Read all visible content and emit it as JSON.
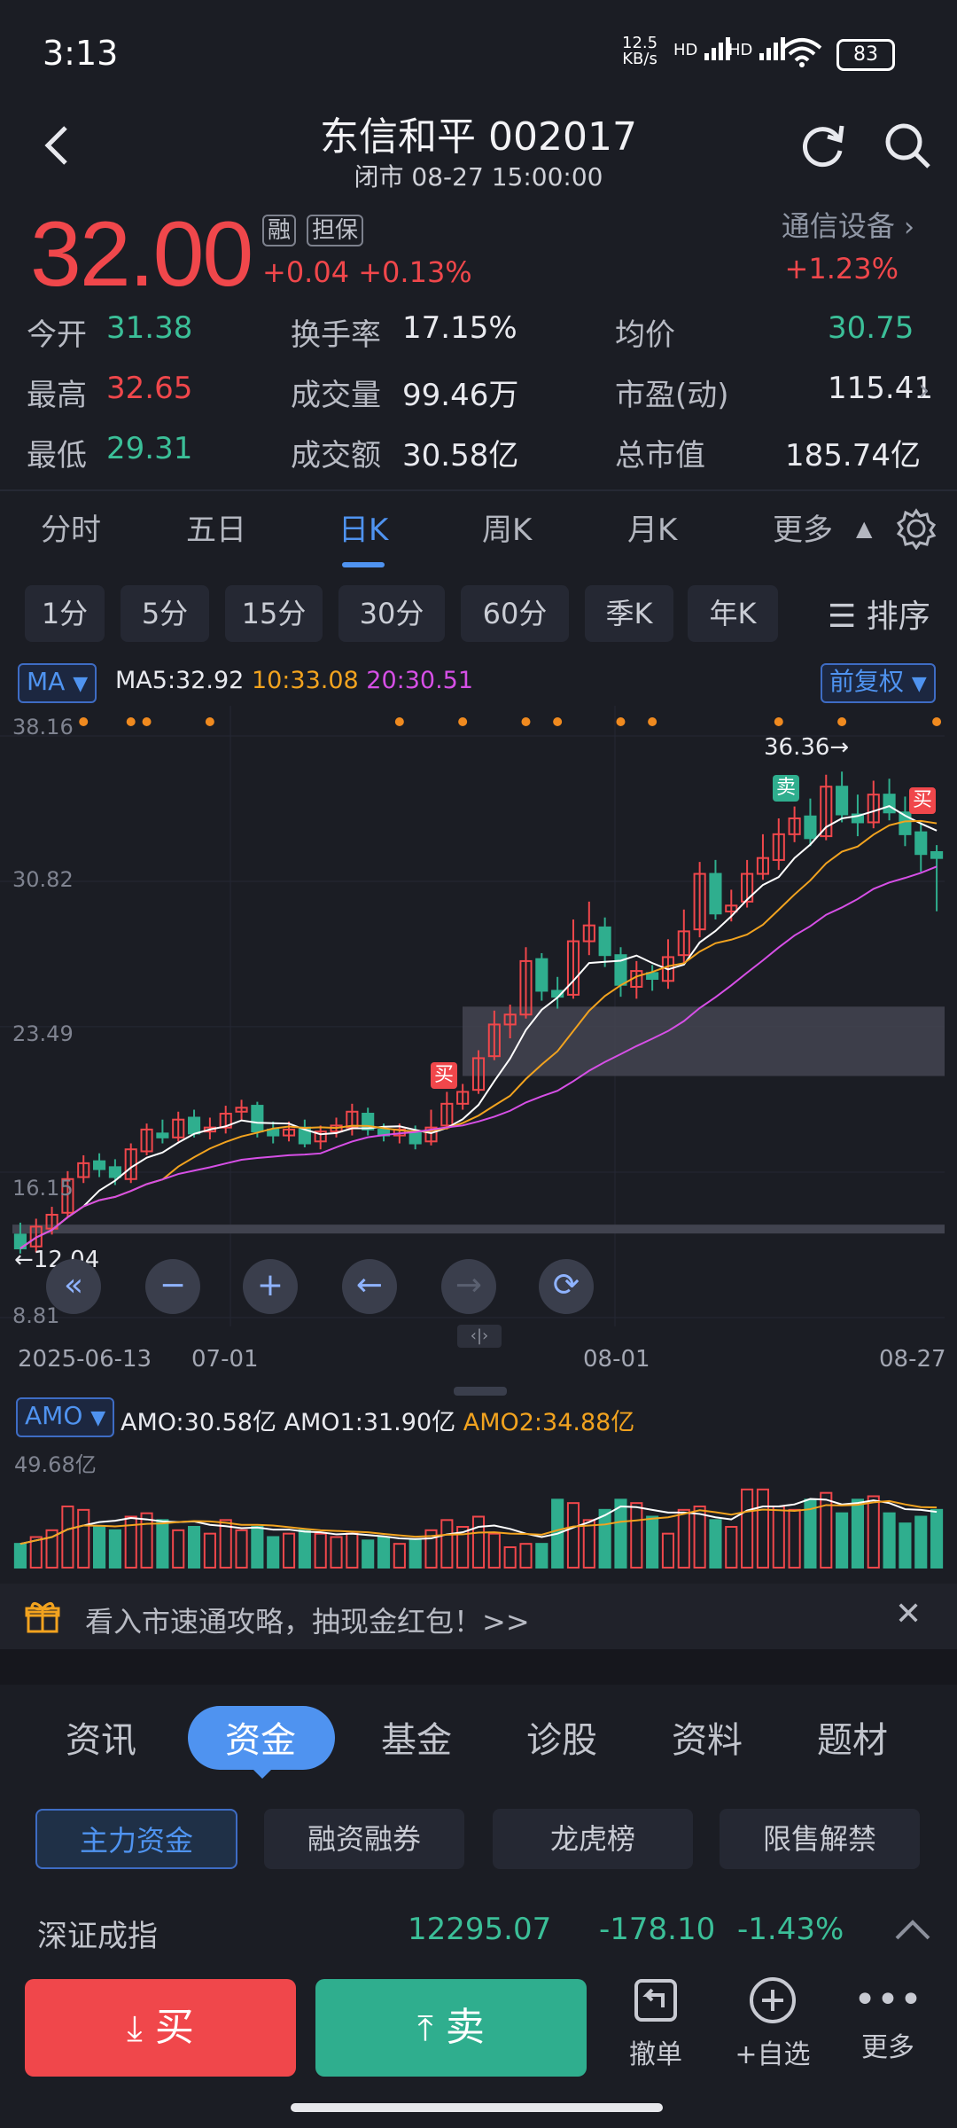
{
  "status": {
    "time": "3:13",
    "net_speed_top": "12.5",
    "net_speed_bottom": "KB/s",
    "hd1": "HD",
    "hd2": "HD",
    "battery": "83"
  },
  "header": {
    "title": "东信和平 002017",
    "subtitle": "闭市 08-27 15:00:00"
  },
  "quote": {
    "price": "32.00",
    "change": "+0.04",
    "change_pct": "+0.13%",
    "badge_rong": "融",
    "badge_danbao": "担保",
    "sector": "通信设备",
    "sector_change": "+1.23%",
    "stats": [
      {
        "label": "今开",
        "value": "31.38",
        "color": "green"
      },
      {
        "label": "换手率",
        "value": "17.15%",
        "color": "white"
      },
      {
        "label": "均价",
        "value": "30.75",
        "color": "green"
      },
      {
        "label": "最高",
        "value": "32.65",
        "color": "red"
      },
      {
        "label": "成交量",
        "value": "99.46万",
        "color": "white"
      },
      {
        "label": "市盈(动)",
        "value": "115.41",
        "color": "white"
      },
      {
        "label": "最低",
        "value": "29.31",
        "color": "green"
      },
      {
        "label": "成交额",
        "value": "30.58亿",
        "color": "white"
      },
      {
        "label": "总市值",
        "value": "185.74亿",
        "color": "white"
      }
    ]
  },
  "ktabs": [
    "分时",
    "五日",
    "日K",
    "周K",
    "月K",
    "更多"
  ],
  "ktab_active": "日K",
  "periods": [
    "1分",
    "5分",
    "15分",
    "30分",
    "60分",
    "季K",
    "年K"
  ],
  "sort_label": "排序",
  "chart": {
    "ma_tag": "MA",
    "ma5": "MA5:32.92",
    "ma10": "10:33.08",
    "ma20": "20:30.51",
    "adj_tag": "前复权",
    "y_ticks": [
      "38.16",
      "30.82",
      "23.49",
      "16.15",
      "8.81"
    ],
    "x_ticks": [
      "2025-06-13",
      "07-01",
      "08-01",
      "08-27"
    ],
    "high_label": "36.36→",
    "low_label": "←12.04",
    "sell_tag": "卖",
    "buy_tag": "买",
    "buy_tag2": "买",
    "amo_tag": "AMO",
    "amo": "AMO:30.58亿",
    "amo1": "AMO1:31.90亿",
    "amo2": "AMO2:34.88亿",
    "amo_max": "49.68亿",
    "colors": {
      "up": "#f0474b",
      "down": "#2fae8e",
      "ma5": "#ffffff",
      "ma10": "#f2a31f",
      "ma20": "#d64fe6"
    }
  },
  "chart_data": {
    "type": "candlestick",
    "x_range": [
      "2025-06-13",
      "08-27"
    ],
    "ylim": [
      8.81,
      38.16
    ],
    "highest": 36.36,
    "lowest": 12.04,
    "candles": [
      [
        13.0,
        12.3,
        13.6,
        12.04
      ],
      [
        12.4,
        13.4,
        13.8,
        12.1
      ],
      [
        13.3,
        14.0,
        14.4,
        13.0
      ],
      [
        14.1,
        15.8,
        16.2,
        13.9
      ],
      [
        15.9,
        16.6,
        17.0,
        15.6
      ],
      [
        16.7,
        16.3,
        17.1,
        15.9
      ],
      [
        16.4,
        15.9,
        16.8,
        15.5
      ],
      [
        15.8,
        17.3,
        17.6,
        15.6
      ],
      [
        17.2,
        18.3,
        18.6,
        17.0
      ],
      [
        18.1,
        17.9,
        18.8,
        17.6
      ],
      [
        17.9,
        18.8,
        19.2,
        17.7
      ],
      [
        18.9,
        18.1,
        19.3,
        17.9
      ],
      [
        18.2,
        18.4,
        18.9,
        17.8
      ],
      [
        18.4,
        19.1,
        19.5,
        18.1
      ],
      [
        19.2,
        19.4,
        19.8,
        18.8
      ],
      [
        19.5,
        18.2,
        19.7,
        17.9
      ],
      [
        18.3,
        18.0,
        18.7,
        17.6
      ],
      [
        18.0,
        18.3,
        18.7,
        17.7
      ],
      [
        18.4,
        17.6,
        18.8,
        17.4
      ],
      [
        17.7,
        18.2,
        18.5,
        17.3
      ],
      [
        18.2,
        18.5,
        18.9,
        17.9
      ],
      [
        18.4,
        19.2,
        19.6,
        18.0
      ],
      [
        19.1,
        18.3,
        19.4,
        18.0
      ],
      [
        18.3,
        18.0,
        18.6,
        17.7
      ],
      [
        18.0,
        18.3,
        18.6,
        17.6
      ],
      [
        18.2,
        17.6,
        18.5,
        17.3
      ],
      [
        17.7,
        18.4,
        19.3,
        17.5
      ],
      [
        18.5,
        19.6,
        20.2,
        18.3
      ],
      [
        19.6,
        20.2,
        20.6,
        19.3
      ],
      [
        20.3,
        21.9,
        22.3,
        20.1
      ],
      [
        22.0,
        23.6,
        24.3,
        21.8
      ],
      [
        23.6,
        24.1,
        24.6,
        22.9
      ],
      [
        24.1,
        26.8,
        27.5,
        23.9
      ],
      [
        26.9,
        25.3,
        27.2,
        24.8
      ],
      [
        25.3,
        25.0,
        26.0,
        24.4
      ],
      [
        25.1,
        27.8,
        28.9,
        24.9
      ],
      [
        27.8,
        28.6,
        29.8,
        27.1
      ],
      [
        28.5,
        27.1,
        29.0,
        26.5
      ],
      [
        27.1,
        25.6,
        27.5,
        25.0
      ],
      [
        25.5,
        26.3,
        26.8,
        24.9
      ],
      [
        26.2,
        25.9,
        26.6,
        25.3
      ],
      [
        25.8,
        27.0,
        27.9,
        25.4
      ],
      [
        27.1,
        28.3,
        29.4,
        26.7
      ],
      [
        28.4,
        31.2,
        31.8,
        28.0
      ],
      [
        31.2,
        29.2,
        31.9,
        28.9
      ],
      [
        29.3,
        29.6,
        30.4,
        28.8
      ],
      [
        29.8,
        31.2,
        31.9,
        29.5
      ],
      [
        31.2,
        32.0,
        33.2,
        30.9
      ],
      [
        31.9,
        33.2,
        34.0,
        31.4
      ],
      [
        33.2,
        34.0,
        34.6,
        32.8
      ],
      [
        34.1,
        33.0,
        35.0,
        32.6
      ],
      [
        33.1,
        35.6,
        36.2,
        32.9
      ],
      [
        35.6,
        34.2,
        36.36,
        33.8
      ],
      [
        34.2,
        33.8,
        35.2,
        33.1
      ],
      [
        33.8,
        35.2,
        35.9,
        33.5
      ],
      [
        35.2,
        34.3,
        36.0,
        33.9
      ],
      [
        34.3,
        33.2,
        35.1,
        32.6
      ],
      [
        33.3,
        32.2,
        33.8,
        31.3
      ],
      [
        32.3,
        32.0,
        32.65,
        29.31
      ]
    ],
    "volume_max": "49.68亿"
  },
  "banner": {
    "text": "看入市速通攻略，抽现金红包！>>"
  },
  "bottom_tabs": [
    "资讯",
    "资金",
    "基金",
    "诊股",
    "资料",
    "题材"
  ],
  "bottom_tab_active": "资金",
  "sub_buttons": [
    "主力资金",
    "融资融券",
    "龙虎榜",
    "限售解禁"
  ],
  "index_row": {
    "name": "深证成指",
    "value": "12295.07",
    "change": "-178.10",
    "pct": "-1.43%"
  },
  "bottom_bar": {
    "buy": "买",
    "sell": "卖",
    "cancel": "撤单",
    "add": "+自选",
    "more": "更多"
  }
}
